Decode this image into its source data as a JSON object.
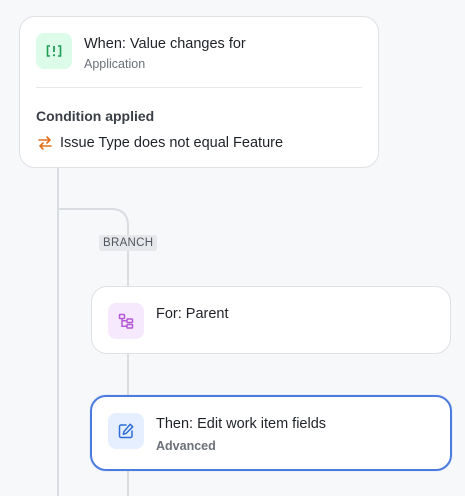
{
  "trigger": {
    "title": "When: Value changes for",
    "subtitle": "Application",
    "icon": "value-change-icon",
    "condition_label": "Condition applied",
    "condition_icon": "swap-arrows-icon",
    "condition_text": "Issue Type does not equal Feature"
  },
  "branch": {
    "badge": "BRANCH"
  },
  "for_step": {
    "title": "For: Parent",
    "icon": "hierarchy-icon"
  },
  "action_step": {
    "title": "Then: Edit work item fields",
    "subtitle": "Advanced",
    "icon": "edit-icon"
  },
  "colors": {
    "trigger_icon_bg": "#dcfbe9",
    "trigger_icon_fg": "#1f9d55",
    "for_icon_bg": "#f6e8fd",
    "for_icon_fg": "#b45ad6",
    "action_icon_bg": "#e6efff",
    "action_icon_fg": "#2f6fd6",
    "swap_icon": "#e2711d",
    "selected_border": "#4c7be0"
  }
}
